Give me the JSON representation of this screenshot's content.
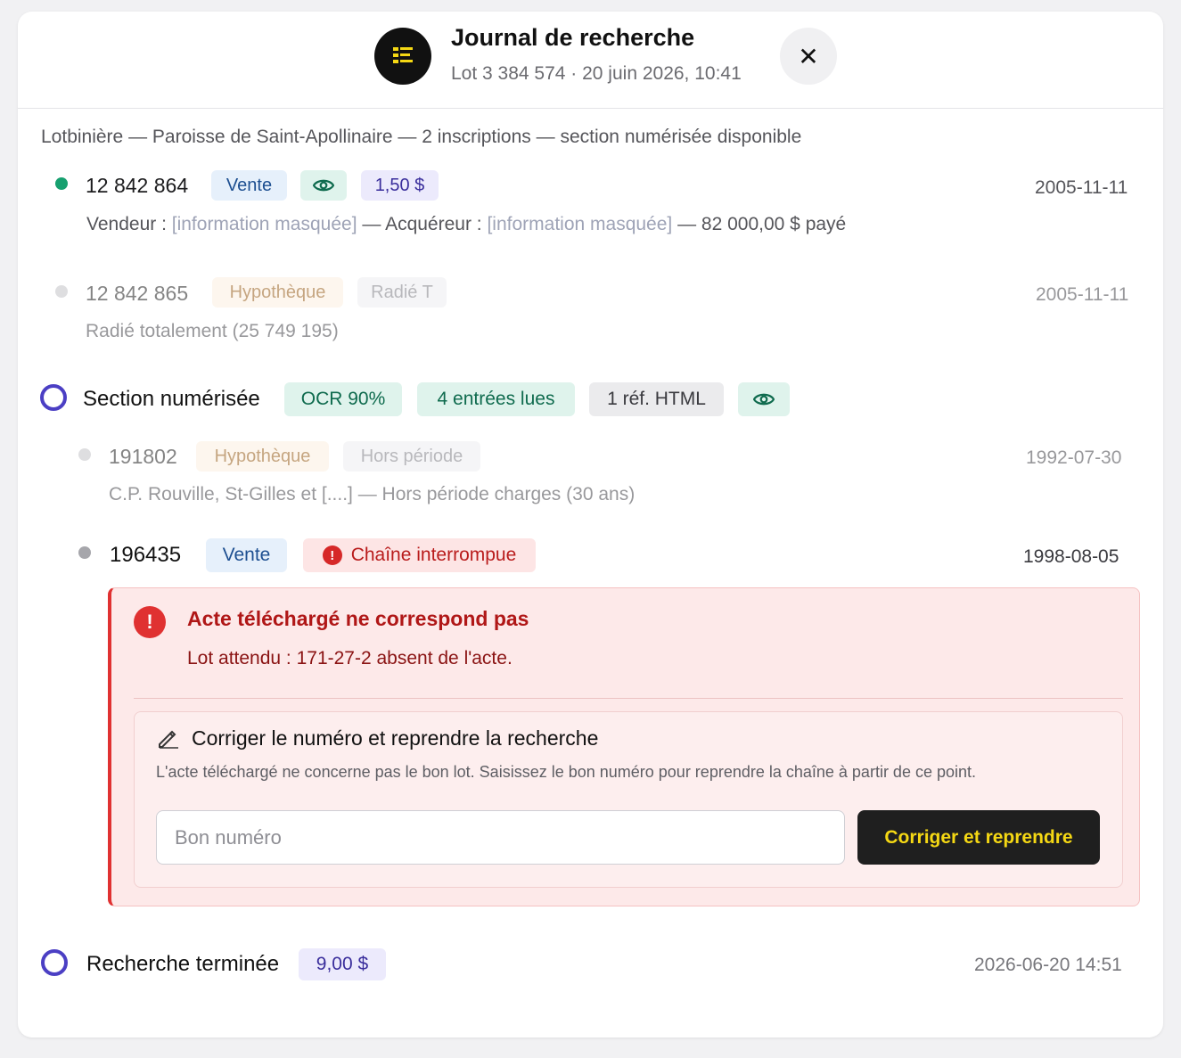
{
  "header": {
    "title": "Journal de recherche",
    "subtitle": "Lot 3 384 574 · 20 juin 2026, 10:41",
    "icon": "list-icon",
    "close_icon": "close-icon"
  },
  "summary": "Lotbinière — Paroisse de Saint-Apollinaire — 2 inscriptions — section numérisée disponible",
  "entries": [
    {
      "number": "12 842 864",
      "type": "Vente",
      "view_icon": "eye-icon",
      "price": "1,50 $",
      "date": "2005-11-11",
      "detail": {
        "seller_label": "Vendeur :",
        "seller_value": "[information masquée]",
        "sep1": "—",
        "buyer_label": "Acquéreur :",
        "buyer_value": "[information masquée]",
        "amount": "— 82 000,00 $ payé"
      },
      "status_color": "#16a06f"
    },
    {
      "number": "12 842 865",
      "type": "Hypothèque",
      "status": "Radié T",
      "date": "2005-11-11",
      "detail": "Radié totalement (25 749 195)"
    }
  ],
  "section": {
    "title": "Section numérisée",
    "ocr": "OCR 90%",
    "entries_read": "4 entrées lues",
    "ref": "1 réf. HTML",
    "view_icon": "eye-icon",
    "entries": [
      {
        "number": "191802",
        "type": "Hypothèque",
        "status": "Hors période",
        "date": "1992-07-30",
        "detail": "C.P. Rouville, St-Gilles et [....] — Hors période charges (30 ans)"
      },
      {
        "number": "196435",
        "type": "Vente",
        "status": "Chaîne interrompue",
        "date": "1998-08-05"
      }
    ]
  },
  "error": {
    "title": "Acte téléchargé ne correspond pas",
    "text": "Lot attendu : 171-27-2 absent de l'acte.",
    "icon": "alert-icon",
    "accent": "#e03131"
  },
  "fix": {
    "title": "Corriger le numéro et reprendre la recherche",
    "description": "L'acte téléchargé ne concerne pas le bon lot. Saisissez le bon numéro pour reprendre la chaîne à partir de ce point.",
    "input_placeholder": "Bon numéro",
    "button_label": "Corriger et reprendre",
    "icon": "pencil-icon"
  },
  "footer": {
    "title": "Recherche terminée",
    "total": "9,00 $",
    "date": "2026-06-20 14:51",
    "accent": "#4b3fc4"
  }
}
